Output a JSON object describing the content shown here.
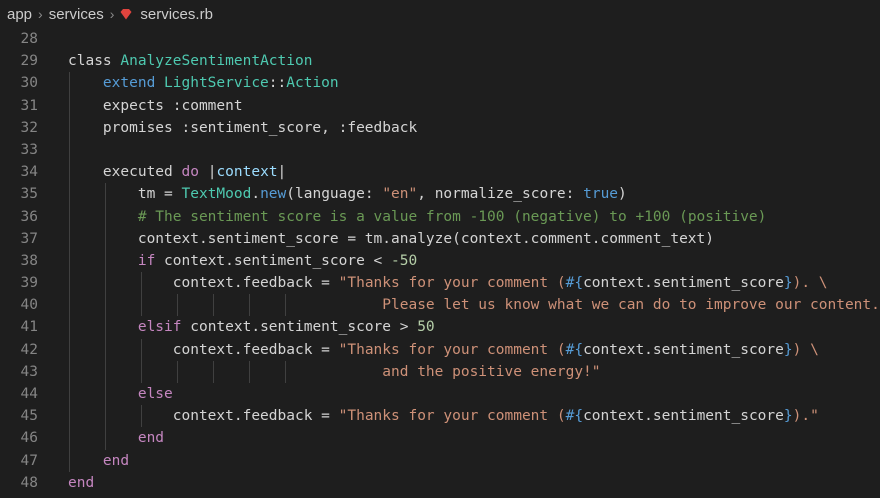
{
  "breadcrumb": {
    "folder1": "app",
    "folder2": "services",
    "file": "services.rb"
  },
  "colors": {
    "background": "#1e1e1e",
    "line_number": "#858585",
    "keyword": "#569cd6",
    "class_name": "#4ec9b0",
    "string": "#ce9178",
    "comment": "#6a9955",
    "ruby_icon": "#e0443e"
  },
  "icons": [
    "chevron-right-icon",
    "ruby-file-icon"
  ],
  "editor": {
    "lines": [
      {
        "n": "28",
        "tokens": []
      },
      {
        "n": "29",
        "tokens": [
          {
            "t": "plain",
            "v": "class "
          },
          {
            "t": "cls",
            "v": "AnalyzeSentimentAction"
          }
        ]
      },
      {
        "n": "30",
        "tokens": [
          {
            "t": "plain",
            "v": "    "
          },
          {
            "t": "kw",
            "v": "extend "
          },
          {
            "t": "cls",
            "v": "LightService"
          },
          {
            "t": "plain",
            "v": "::"
          },
          {
            "t": "cls",
            "v": "Action"
          }
        ]
      },
      {
        "n": "31",
        "tokens": [
          {
            "t": "plain",
            "v": "    expects :comment"
          }
        ]
      },
      {
        "n": "32",
        "tokens": [
          {
            "t": "plain",
            "v": "    promises :sentiment_score, :feedback"
          }
        ]
      },
      {
        "n": "33",
        "tokens": []
      },
      {
        "n": "34",
        "tokens": [
          {
            "t": "plain",
            "v": "    executed "
          },
          {
            "t": "ctl",
            "v": "do"
          },
          {
            "t": "plain",
            "v": " |"
          },
          {
            "t": "var",
            "v": "context"
          },
          {
            "t": "plain",
            "v": "|"
          }
        ]
      },
      {
        "n": "35",
        "tokens": [
          {
            "t": "plain",
            "v": "        tm = "
          },
          {
            "t": "cls",
            "v": "TextMood"
          },
          {
            "t": "plain",
            "v": "."
          },
          {
            "t": "kw",
            "v": "new"
          },
          {
            "t": "plain",
            "v": "(language: "
          },
          {
            "t": "str",
            "v": "\"en\""
          },
          {
            "t": "plain",
            "v": ", normalize_score: "
          },
          {
            "t": "kw",
            "v": "true"
          },
          {
            "t": "plain",
            "v": ")"
          }
        ]
      },
      {
        "n": "36",
        "tokens": [
          {
            "t": "plain",
            "v": "        "
          },
          {
            "t": "cmt",
            "v": "# The sentiment score is a value from -100 (negative) to +100 (positive)"
          }
        ]
      },
      {
        "n": "37",
        "tokens": [
          {
            "t": "plain",
            "v": "        context.sentiment_score = tm.analyze(context.comment.comment_text)"
          }
        ]
      },
      {
        "n": "38",
        "tokens": [
          {
            "t": "plain",
            "v": "        "
          },
          {
            "t": "ctl",
            "v": "if"
          },
          {
            "t": "plain",
            "v": " context.sentiment_score < "
          },
          {
            "t": "num",
            "v": "-50"
          }
        ]
      },
      {
        "n": "39",
        "tokens": [
          {
            "t": "plain",
            "v": "            context.feedback = "
          },
          {
            "t": "str",
            "v": "\"Thanks for your comment ("
          },
          {
            "t": "kw",
            "v": "#{"
          },
          {
            "t": "plain",
            "v": "context.sentiment_score"
          },
          {
            "t": "kw",
            "v": "}"
          },
          {
            "t": "str",
            "v": "). \\"
          }
        ]
      },
      {
        "n": "40",
        "tokens": [
          {
            "t": "str",
            "v": "                                    Please let us know what we can do to improve our content.\""
          }
        ]
      },
      {
        "n": "41",
        "tokens": [
          {
            "t": "plain",
            "v": "        "
          },
          {
            "t": "ctl",
            "v": "elsif"
          },
          {
            "t": "plain",
            "v": " context.sentiment_score > "
          },
          {
            "t": "num",
            "v": "50"
          }
        ]
      },
      {
        "n": "42",
        "tokens": [
          {
            "t": "plain",
            "v": "            context.feedback = "
          },
          {
            "t": "str",
            "v": "\"Thanks for your comment ("
          },
          {
            "t": "kw",
            "v": "#{"
          },
          {
            "t": "plain",
            "v": "context.sentiment_score"
          },
          {
            "t": "kw",
            "v": "}"
          },
          {
            "t": "str",
            "v": ") \\"
          }
        ]
      },
      {
        "n": "43",
        "tokens": [
          {
            "t": "str",
            "v": "                                    and the positive energy!\""
          }
        ]
      },
      {
        "n": "44",
        "tokens": [
          {
            "t": "plain",
            "v": "        "
          },
          {
            "t": "ctl",
            "v": "else"
          }
        ]
      },
      {
        "n": "45",
        "tokens": [
          {
            "t": "plain",
            "v": "            context.feedback = "
          },
          {
            "t": "str",
            "v": "\"Thanks for your comment ("
          },
          {
            "t": "kw",
            "v": "#{"
          },
          {
            "t": "plain",
            "v": "context.sentiment_score"
          },
          {
            "t": "kw",
            "v": "}"
          },
          {
            "t": "str",
            "v": ").\""
          }
        ]
      },
      {
        "n": "46",
        "tokens": [
          {
            "t": "plain",
            "v": "        "
          },
          {
            "t": "ctl",
            "v": "end"
          }
        ]
      },
      {
        "n": "47",
        "tokens": [
          {
            "t": "plain",
            "v": "    "
          },
          {
            "t": "ctl",
            "v": "end"
          }
        ]
      },
      {
        "n": "48",
        "tokens": [
          {
            "t": "ctl",
            "v": "end"
          }
        ]
      }
    ]
  }
}
